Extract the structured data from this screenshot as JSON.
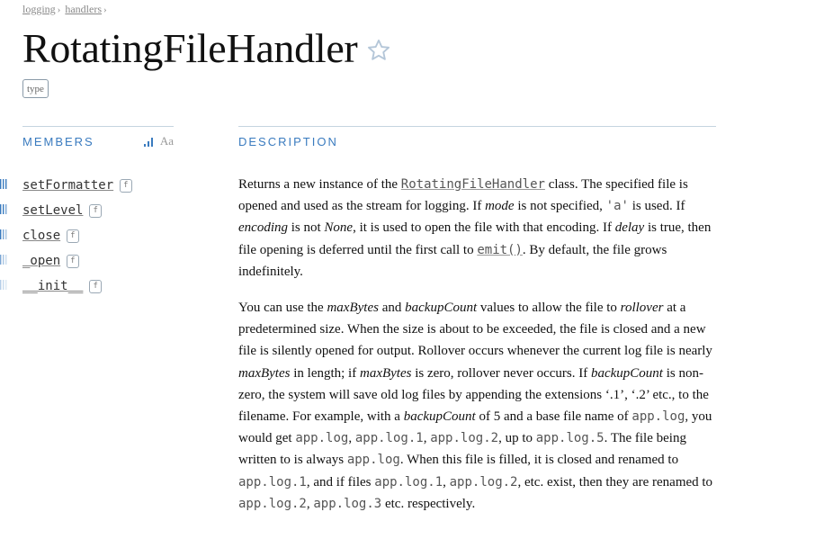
{
  "breadcrumb": {
    "items": [
      {
        "label": "logging"
      },
      {
        "label": "handlers"
      }
    ],
    "separator": "›"
  },
  "title": "RotatingFileHandler",
  "type_badge": "type",
  "members": {
    "header": "MEMBERS",
    "sort_toggle": "Aa",
    "items": [
      {
        "name": "setFormatter",
        "kind": "f"
      },
      {
        "name": "setLevel",
        "kind": "f"
      },
      {
        "name": "close",
        "kind": "f"
      },
      {
        "name": "_open",
        "kind": "f"
      },
      {
        "name": "__init__",
        "kind": "f"
      }
    ]
  },
  "description": {
    "header": "DESCRIPTION",
    "p1": {
      "s1": "Returns a new instance of the ",
      "class_ref": "RotatingFileHandler",
      "s2": " class. The specified file is opened and used as the stream for logging. If ",
      "mode": "mode",
      "s3": " is not specified, ",
      "a_literal": "'a'",
      "s4": " is used. If ",
      "encoding": "encoding",
      "s5": " is not ",
      "none": "None",
      "s6": ", it is used to open the file with that encoding. If ",
      "delay": "delay",
      "s7": " is true, then file opening is deferred until the first call to ",
      "emit": "emit()",
      "s8": ". By default, the file grows indefinitely."
    },
    "p2": {
      "s1": "You can use the ",
      "maxbytes": "maxBytes",
      "s2": " and ",
      "backupcount": "backupCount",
      "s3": " values to allow the file to ",
      "rollover": "rollover",
      "s4": " at a predetermined size. When the size is about to be exceeded, the file is closed and a new file is silently opened for output. Rollover occurs whenever the current log file is nearly ",
      "maxbytes2": "maxBytes",
      "s5": " in length; if ",
      "maxbytes3": "maxBytes",
      "s6": " is zero, rollover never occurs. If ",
      "backupcount2": "backupCount",
      "s7": " is non-zero, the system will save old log files by appending the extensions ‘.1’, ‘.2’ etc., to the filename. For example, with a ",
      "backupcount3": "backupCount",
      "s8": " of 5 and a base file name of ",
      "c1": "app.log",
      "s9": ", you would get ",
      "c2": "app.log",
      "s10": ", ",
      "c3": "app.log.1",
      "s11": ", ",
      "c4": "app.log.2",
      "s12": ", up to ",
      "c5": "app.log.5",
      "s13": ". The file being written to is always ",
      "c6": "app.log",
      "s14": ". When this file is filled, it is closed and renamed to ",
      "c7": "app.log.1",
      "s15": ", and if files ",
      "c8": "app.log.1",
      "s16": ", ",
      "c9": "app.log.2",
      "s17": ", etc. exist, then they are renamed to ",
      "c10": "app.log.2",
      "s18": ", ",
      "c11": "app.log.3",
      "s19": " etc. respectively."
    }
  },
  "colors": {
    "accent": "#3a7bbf",
    "rule": "#c5d4e0",
    "muted": "#888888"
  },
  "icons": [
    "star-icon",
    "bars-icon",
    "usage-icon"
  ]
}
